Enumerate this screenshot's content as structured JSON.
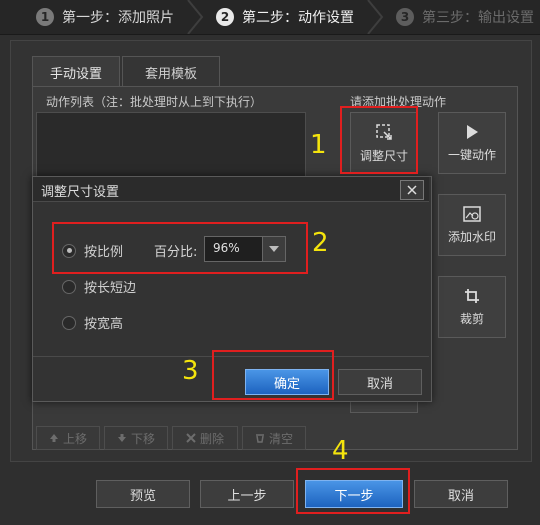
{
  "steps": [
    {
      "num": "1",
      "label": "第一步：添加照片"
    },
    {
      "num": "2",
      "label": "第二步：动作设置"
    },
    {
      "num": "3",
      "label": "第三步：输出设置"
    }
  ],
  "tabs": {
    "manual": "手动设置",
    "template": "套用模板"
  },
  "labels": {
    "action_list": "动作列表（注：批处理时从上到下执行）",
    "add_actions": "请添加批处理动作"
  },
  "side_buttons": {
    "resize": "调整尺寸",
    "one_click": "一键动作",
    "watermark": "添加水印",
    "crop": "裁剪"
  },
  "dialog": {
    "title": "调整尺寸设置",
    "options": {
      "ratio": "按比例",
      "long_short": "按长短边",
      "width_height": "按宽高"
    },
    "percent_label": "百分比:",
    "percent_value": "96%",
    "ok": "确定",
    "cancel": "取消"
  },
  "list_buttons": {
    "up": "上移",
    "down": "下移",
    "delete": "删除",
    "clear": "清空"
  },
  "bottom_buttons": {
    "preview": "预览",
    "prev": "上一步",
    "next": "下一步",
    "cancel": "取消"
  },
  "annotations": [
    "1",
    "2",
    "3",
    "4"
  ],
  "colors": {
    "accent": "#1d63bf",
    "highlight": "#e01f1f",
    "annotation": "#f4e40d"
  }
}
